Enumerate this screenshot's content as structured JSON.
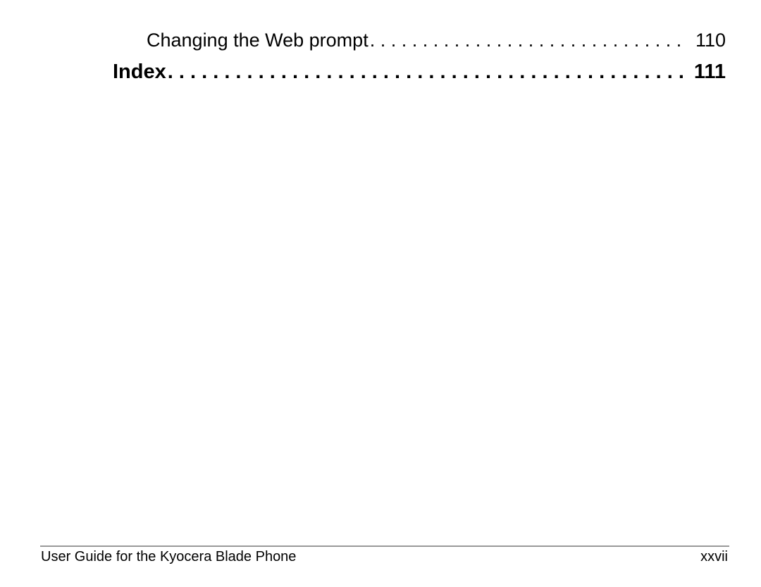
{
  "toc": [
    {
      "title": "Changing the Web prompt",
      "page": "110",
      "level": "sub"
    },
    {
      "title": "Index",
      "page": "111",
      "level": "chapter"
    }
  ],
  "footer": {
    "title": "User Guide for the Kyocera Blade Phone",
    "page_number": "xxvii"
  }
}
